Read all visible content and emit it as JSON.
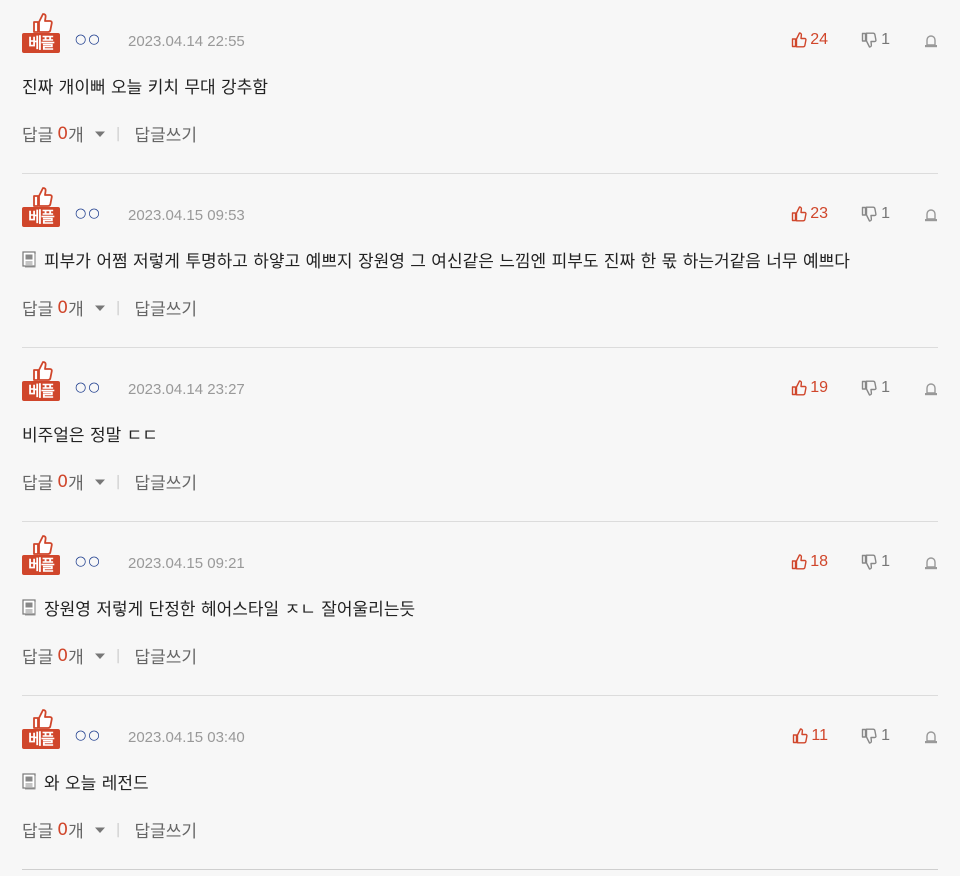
{
  "badge_label": "베플",
  "actions": {
    "reply_label": "답글",
    "reply_unit": "개",
    "separator": "|",
    "write_label": "답글쓰기"
  },
  "colors": {
    "accent": "#d0462b",
    "nick": "#1a3a8c"
  },
  "comments": [
    {
      "nick": "○○",
      "date": "2023.04.14 22:55",
      "likes": "24",
      "dislikes": "1",
      "has_image": false,
      "text": "진짜 개이뻐 오늘 키치 무대 강추함",
      "reply_count": "0"
    },
    {
      "nick": "○○",
      "date": "2023.04.15 09:53",
      "likes": "23",
      "dislikes": "1",
      "has_image": true,
      "text": "피부가 어쩜 저렇게 투명하고 하얗고 예쁘지 장원영 그 여신같은 느낌엔 피부도 진짜 한 몫 하는거같음 너무 예쁘다",
      "reply_count": "0"
    },
    {
      "nick": "○○",
      "date": "2023.04.14 23:27",
      "likes": "19",
      "dislikes": "1",
      "has_image": false,
      "text": "비주얼은 정말 ㄷㄷ",
      "reply_count": "0"
    },
    {
      "nick": "○○",
      "date": "2023.04.15 09:21",
      "likes": "18",
      "dislikes": "1",
      "has_image": true,
      "text": "장원영 저렇게 단정한 헤어스타일 ㅈㄴ 잘어울리는듯",
      "reply_count": "0"
    },
    {
      "nick": "○○",
      "date": "2023.04.15 03:40",
      "likes": "11",
      "dislikes": "1",
      "has_image": true,
      "text": "와 오늘 레전드",
      "reply_count": "0"
    }
  ]
}
